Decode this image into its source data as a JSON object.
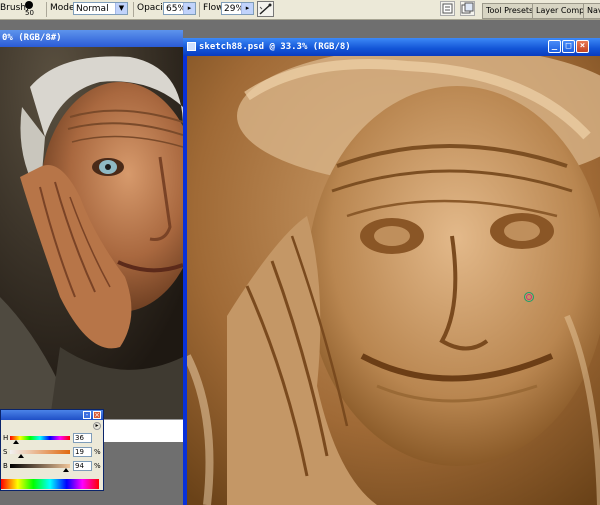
{
  "options_bar": {
    "brush_label": "Brush:",
    "brush_size": "50",
    "mode_label": "Mode:",
    "mode_value": "Normal",
    "opacity_label": "Opacity:",
    "opacity_value": "65%",
    "flow_label": "Flow:",
    "flow_value": "29%",
    "airbrush_icon": "airbrush-icon",
    "panel_tabs": [
      "Tool Presets",
      "Layer Comps",
      "Navi"
    ]
  },
  "back_window": {
    "title_fragment": "0% (RGB/8#)"
  },
  "front_window": {
    "title": "sketch88.psd @ 33.3% (RGB/8)",
    "min_symbol": "_",
    "max_symbol": "□",
    "close_symbol": "×"
  },
  "color_palette": {
    "menu_symbol": "▸",
    "close_symbol": "×",
    "min_symbol": "-",
    "channels": [
      {
        "label": "H",
        "value": "36",
        "suffix": "",
        "level": 0.1
      },
      {
        "label": "S",
        "value": "19",
        "suffix": "%",
        "level": 0.19
      },
      {
        "label": "B",
        "value": "94",
        "suffix": "%",
        "level": 0.94
      }
    ]
  },
  "colors": {
    "xp_titlebar_blue": "#0a3bbf",
    "sepia_dark": "#6a4218",
    "sepia_light": "#e3b98a",
    "options_bar_bg": "#ece9d8"
  }
}
